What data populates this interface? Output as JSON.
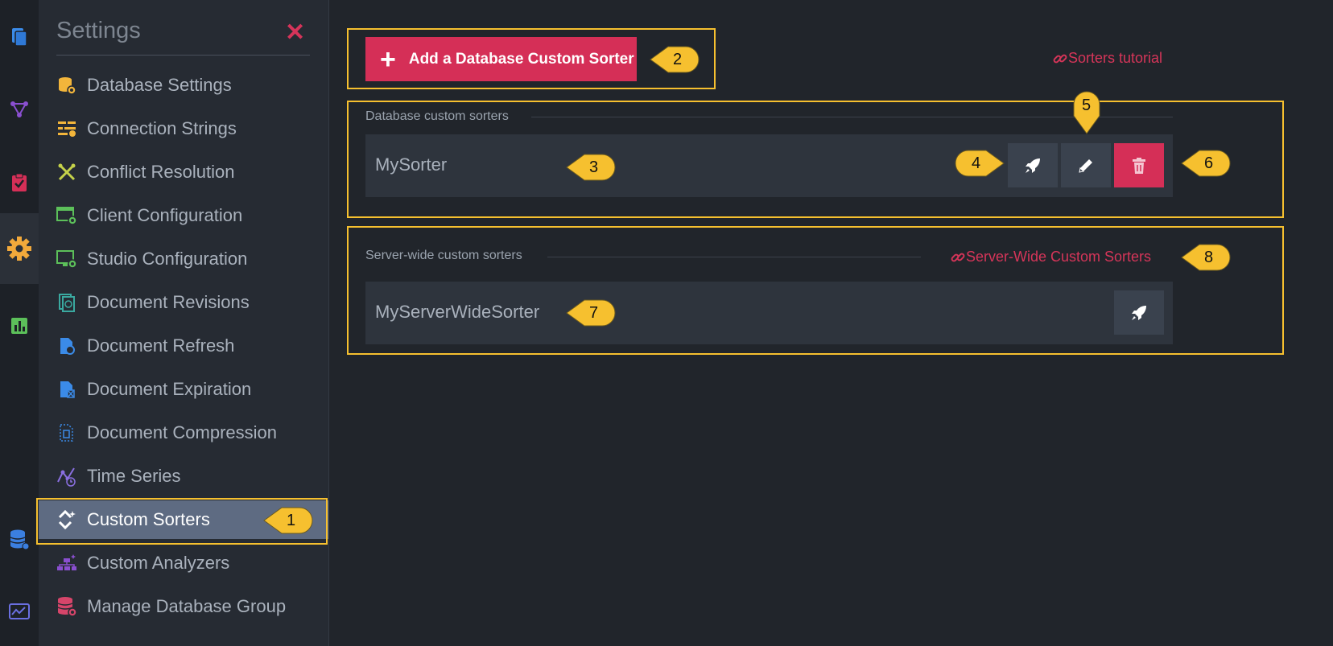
{
  "panel": {
    "title": "Settings",
    "close_glyph": "✕",
    "items": [
      {
        "label": "Database Settings",
        "icon": "database-settings-icon"
      },
      {
        "label": "Connection Strings",
        "icon": "connection-strings-icon"
      },
      {
        "label": "Conflict Resolution",
        "icon": "conflict-resolution-icon"
      },
      {
        "label": "Client Configuration",
        "icon": "client-configuration-icon"
      },
      {
        "label": "Studio Configuration",
        "icon": "studio-configuration-icon"
      },
      {
        "label": "Document Revisions",
        "icon": "document-revisions-icon"
      },
      {
        "label": "Document Refresh",
        "icon": "document-refresh-icon"
      },
      {
        "label": "Document Expiration",
        "icon": "document-expiration-icon"
      },
      {
        "label": "Document Compression",
        "icon": "document-compression-icon"
      },
      {
        "label": "Time Series",
        "icon": "time-series-icon"
      },
      {
        "label": "Custom Sorters",
        "icon": "custom-sorters-icon",
        "active": true
      },
      {
        "label": "Custom Analyzers",
        "icon": "custom-analyzers-icon"
      },
      {
        "label": "Manage Database Group",
        "icon": "manage-database-group-icon"
      }
    ]
  },
  "main": {
    "add_button_label": "Add a Database Custom Sorter",
    "sorters_tutorial_link": "Sorters tutorial",
    "database_section": {
      "label": "Database custom sorters",
      "sorters": [
        {
          "name": "MySorter"
        }
      ]
    },
    "server_section": {
      "label": "Server-wide custom sorters",
      "link": "Server-Wide Custom Sorters",
      "sorters": [
        {
          "name": "MyServerWideSorter"
        }
      ]
    }
  },
  "annotations": {
    "badge1": "1",
    "badge2": "2",
    "badge3": "3",
    "badge4": "4",
    "badge5": "5",
    "badge6": "6",
    "badge7": "7",
    "badge8": "8"
  },
  "colors": {
    "accent": "#d52f57",
    "highlight": "#f6c02f",
    "background": "#21252b",
    "panel": "#262b33",
    "active_item": "#5e6b82"
  }
}
